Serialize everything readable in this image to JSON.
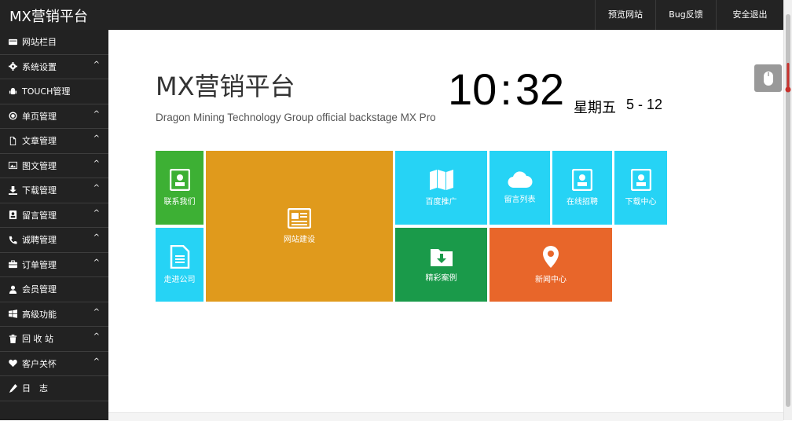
{
  "header": {
    "brand": "MX营销平台",
    "nav": [
      "预览网站",
      "Bug反馈",
      "安全退出"
    ]
  },
  "sidebar": {
    "items": [
      {
        "label": "网站栏目",
        "icon": "list-icon",
        "expandable": false
      },
      {
        "label": "系统设置",
        "icon": "gear-icon",
        "expandable": true
      },
      {
        "label": "TOUCH管理",
        "icon": "android-icon",
        "expandable": false
      },
      {
        "label": "单页管理",
        "icon": "globe-icon",
        "expandable": true
      },
      {
        "label": "文章管理",
        "icon": "file-icon",
        "expandable": true
      },
      {
        "label": "图文管理",
        "icon": "image-icon",
        "expandable": true
      },
      {
        "label": "下载管理",
        "icon": "download-icon",
        "expandable": true
      },
      {
        "label": "留言管理",
        "icon": "contact-card-icon",
        "expandable": true
      },
      {
        "label": "诚聘管理",
        "icon": "phone-icon",
        "expandable": true
      },
      {
        "label": "订单管理",
        "icon": "briefcase-icon",
        "expandable": true
      },
      {
        "label": "会员管理",
        "icon": "user-icon",
        "expandable": false
      },
      {
        "label": "高级功能",
        "icon": "windows-icon",
        "expandable": true
      },
      {
        "label": "回 收 站",
        "icon": "trash-icon",
        "expandable": true
      },
      {
        "label": "客户关怀",
        "icon": "heart-icon",
        "expandable": true
      },
      {
        "label": "日　志",
        "icon": "pencil-icon",
        "expandable": false
      }
    ]
  },
  "main": {
    "title": "MX营销平台",
    "subtitle": "Dragon Mining Technology Group official backstage MX Pro",
    "clock": {
      "hour": "10",
      "sep": ":",
      "minute": "32"
    },
    "weekday": "星期五",
    "date": "5 - 12"
  },
  "tiles": [
    {
      "label": "联系我们",
      "icon": "contact-card-icon",
      "color": "#3db034"
    },
    {
      "label": "走进公司",
      "icon": "document-icon",
      "color": "#26d3f5"
    },
    {
      "label": "网站建设",
      "icon": "newspaper-icon",
      "color": "#e09a1c"
    },
    {
      "label": "百度推广",
      "icon": "map-icon",
      "color": "#26d3f5"
    },
    {
      "label": "留言列表",
      "icon": "cloud-icon",
      "color": "#26d3f5"
    },
    {
      "label": "在线招聘",
      "icon": "contact-card-icon",
      "color": "#26d3f5"
    },
    {
      "label": "下载中心",
      "icon": "contact-card-icon",
      "color": "#26d3f5"
    },
    {
      "label": "精彩案例",
      "icon": "folder-download-icon",
      "color": "#1a9a4a"
    },
    {
      "label": "新闻中心",
      "icon": "map-pin-icon",
      "color": "#e8662a"
    }
  ]
}
